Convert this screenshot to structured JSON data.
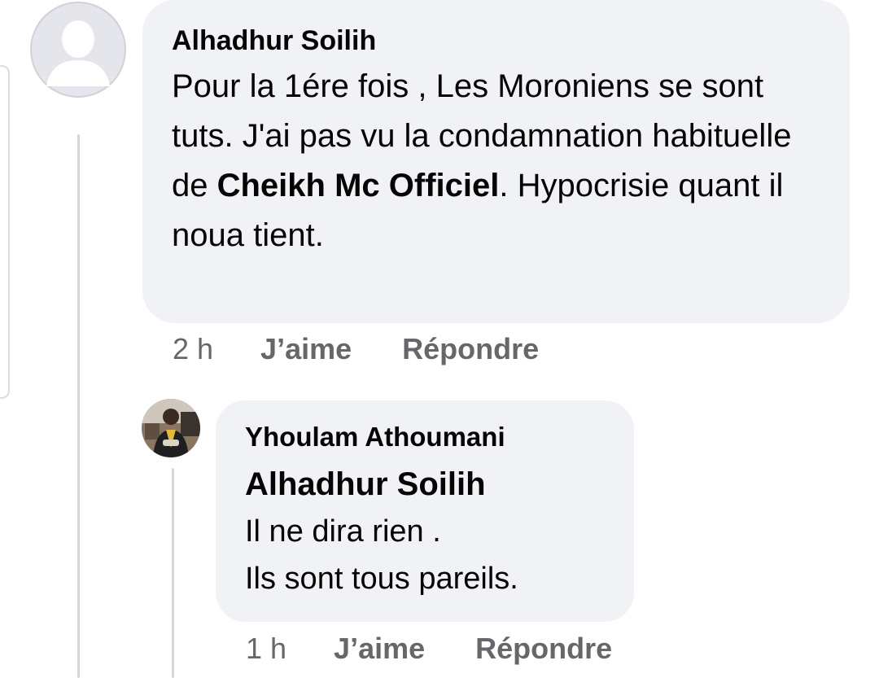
{
  "comment": {
    "author": "Alhadhur Soilih",
    "text_before": "Pour la 1ére fois , Les Moroniens se sont tuts. J'ai pas vu la condamnation habituelle de ",
    "mention": "Cheikh Mc Officiel",
    "text_after": ". Hypocrisie quant il noua tient.",
    "time": "2 h",
    "like_label": "J’aime",
    "reply_label": "Répondre",
    "avatar_icon": "default-profile-icon"
  },
  "reply": {
    "author": "Yhoulam Athoumani",
    "mention": "Alhadhur Soilih",
    "lines": [
      "Il ne dira rien .",
      "Ils sont tous pareils."
    ],
    "time": "1 h",
    "like_label": "J’aime",
    "reply_label": "Répondre",
    "avatar_icon": "user-photo-avatar"
  },
  "colors": {
    "bubble_bg": "#f0f2f5",
    "meta_text": "#65676b",
    "thread_line": "#d4d6da",
    "text": "#050505"
  }
}
